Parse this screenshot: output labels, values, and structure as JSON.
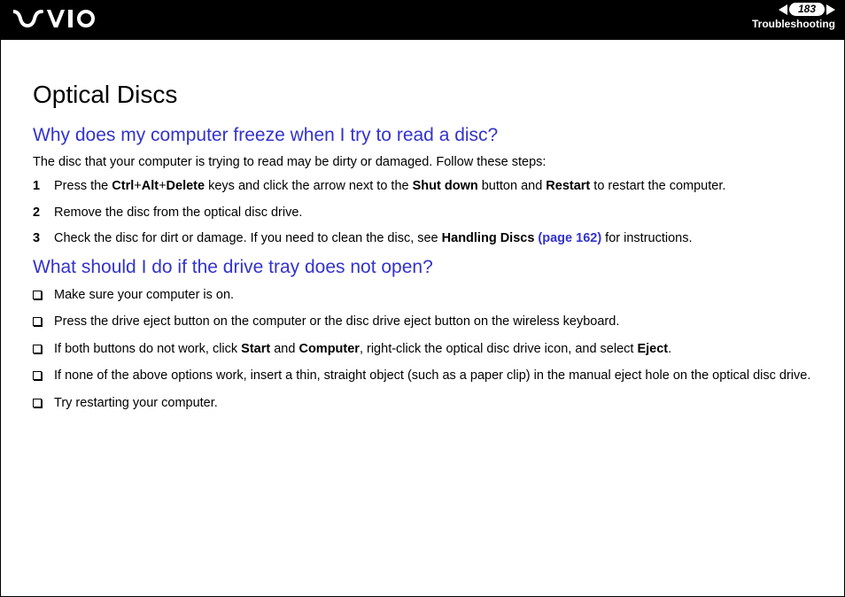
{
  "header": {
    "page_number": "183",
    "section": "Troubleshooting"
  },
  "page": {
    "title": "Optical Discs",
    "q1": {
      "heading": "Why does my computer freeze when I try to read a disc?",
      "intro": "The disc that your computer is trying to read may be dirty or damaged. Follow these steps:",
      "steps": [
        {
          "n": "1",
          "pre": "Press the ",
          "b1": "Ctrl",
          "mid1": "+",
          "b2": "Alt",
          "mid2": "+",
          "b3": "Delete",
          "mid3": " keys and click the arrow next to the ",
          "b4": "Shut down",
          "mid4": " button and ",
          "b5": "Restart",
          "post": " to restart the computer."
        },
        {
          "n": "2",
          "text": "Remove the disc from the optical disc drive."
        },
        {
          "n": "3",
          "pre": "Check the disc for dirt or damage. If you need to clean the disc, see ",
          "b1": "Handling Discs",
          "link": " (page 162)",
          "post": " for instructions."
        }
      ]
    },
    "q2": {
      "heading": "What should I do if the drive tray does not open?",
      "items": [
        {
          "text": "Make sure your computer is on."
        },
        {
          "text": "Press the drive eject button on the computer or the disc drive eject button on the wireless keyboard."
        },
        {
          "pre": "If both buttons do not work, click ",
          "b1": "Start",
          "mid1": " and ",
          "b2": "Computer",
          "mid2": ", right-click the optical disc drive icon, and select ",
          "b3": "Eject",
          "post": "."
        },
        {
          "text": "If none of the above options work, insert a thin, straight object (such as a paper clip) in the manual eject hole on the optical disc drive."
        },
        {
          "text": "Try restarting your computer."
        }
      ]
    }
  }
}
